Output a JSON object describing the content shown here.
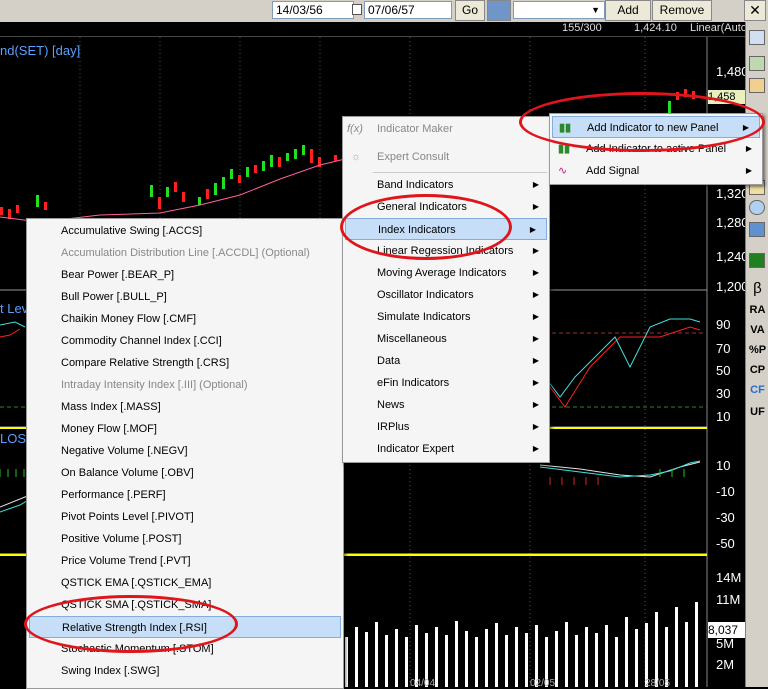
{
  "toolbar": {
    "date_from": "14/03/56",
    "date_to": "07/06/57",
    "go_label": "Go",
    "add_label": "Add",
    "remove_label": "Remove"
  },
  "status": {
    "chart_title": "nd(SET) [day]",
    "count": "155/300",
    "price": "1,424.10",
    "scale": "Linear(Auto"
  },
  "axis": {
    "price_ticks": [
      "1,480",
      "1,320",
      "1,280",
      "1,240",
      "1,200"
    ],
    "rsi_ticks": [
      "90",
      "70",
      "50",
      "30",
      "10"
    ],
    "osc_ticks": [
      "10",
      "-10",
      "-30",
      "-50"
    ],
    "vol_ticks": [
      "14M",
      "11M",
      "8,037",
      "5M",
      "2M"
    ],
    "date_ticks": [
      "04/04",
      "02/05",
      "28/05"
    ],
    "price_tag": "1,458"
  },
  "chart_labels": {
    "rsi_panel": "t Lev",
    "osc_panel": "LOS"
  },
  "rightbar": {
    "labels": [
      "β",
      "RA",
      "VA",
      "%P",
      "CP",
      "CF",
      "UF"
    ]
  },
  "menu_main": {
    "items": [
      {
        "label": "Indicator Maker"
      },
      {
        "label": "Expert Consult"
      },
      {
        "label": "Band Indicators"
      },
      {
        "label": "General Indicators"
      },
      {
        "label": "Index Indicators"
      },
      {
        "label": "Linear Regession Indicators"
      },
      {
        "label": "Moving Average Indicators"
      },
      {
        "label": "Oscillator Indicators"
      },
      {
        "label": "Simulate Indicators"
      },
      {
        "label": "Miscellaneous"
      },
      {
        "label": "Data"
      },
      {
        "label": "eFin Indicators"
      },
      {
        "label": "News"
      },
      {
        "label": "IRPlus"
      },
      {
        "label": "Indicator Expert"
      }
    ]
  },
  "menu_add": {
    "items": [
      {
        "label": "Add Indicator to new Panel"
      },
      {
        "label": "Add Indicator to active Panel"
      },
      {
        "label": "Add Signal"
      }
    ]
  },
  "menu_index": {
    "items": [
      {
        "label": "Accumulative Swing [.ACCS]"
      },
      {
        "label": "Accumulation Distribution Line [.ACCDL] (Optional)"
      },
      {
        "label": "Bear Power [.BEAR_P]"
      },
      {
        "label": "Bull Power [.BULL_P]"
      },
      {
        "label": "Chaikin Money Flow [.CMF]"
      },
      {
        "label": "Commodity Channel Index [.CCI]"
      },
      {
        "label": "Compare Relative Strength [.CRS]"
      },
      {
        "label": "Intraday Intensity Index [.III] (Optional)"
      },
      {
        "label": "Mass Index [.MASS]"
      },
      {
        "label": "Money Flow [.MOF]"
      },
      {
        "label": "Negative Volume [.NEGV]"
      },
      {
        "label": "On Balance Volume [.OBV]"
      },
      {
        "label": "Performance [.PERF]"
      },
      {
        "label": "Pivot Points Level [.PIVOT]"
      },
      {
        "label": "Positive Volume [.POST]"
      },
      {
        "label": "Price Volume Trend [.PVT]"
      },
      {
        "label": "QSTICK EMA [.QSTICK_EMA]"
      },
      {
        "label": "QSTICK SMA [.QSTICK_SMA]"
      },
      {
        "label": "Relative Strength Index [.RSI]"
      },
      {
        "label": "Stochastic Momentum [.STOM]"
      },
      {
        "label": "Swing Index [.SWG]"
      }
    ]
  }
}
